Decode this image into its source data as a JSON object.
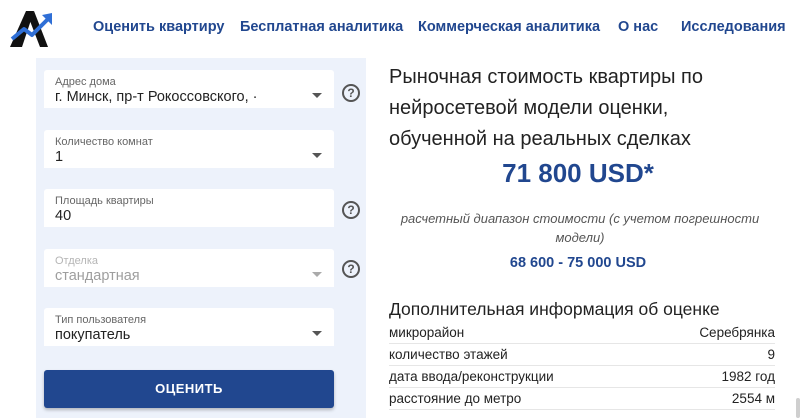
{
  "header": {
    "logo_icon": "analytics-arrow-logo",
    "nav": [
      {
        "label": "Оценить квартиру"
      },
      {
        "label": "Бесплатная аналитика"
      },
      {
        "label": "Коммерческая аналитика"
      },
      {
        "label": "О нас"
      },
      {
        "label": "Исследования"
      }
    ]
  },
  "form": {
    "address": {
      "label": "Адрес дома",
      "value": "г. Минск, пр-т Рокоссовского, ·"
    },
    "rooms": {
      "label": "Количество комнат",
      "value": "1"
    },
    "area": {
      "label": "Площадь квартиры",
      "value": "40"
    },
    "finish": {
      "label": "Отделка",
      "value": "стандартная"
    },
    "user_type": {
      "label": "Тип пользователя",
      "value": "покупатель"
    },
    "help_glyph": "?",
    "submit_label": "ОЦЕНИТЬ"
  },
  "result": {
    "title": "Рыночная стоимость квартиры по нейросетевой модели оценки, обученной на реальных сделках",
    "price": "71 800 USD*",
    "range_note": "расчетный диапазон стоимости (с учетом погрешности модели)",
    "range": "68 600 - 75 000 USD",
    "extra_title": "Дополнительная информация об оценке",
    "rows": [
      {
        "k": "микрорайон",
        "v": "Серебрянка"
      },
      {
        "k": "количество этажей",
        "v": "9"
      },
      {
        "k": "дата ввода/реконструкции",
        "v": "1982 год"
      },
      {
        "k": "расстояние до метро",
        "v": "2554 м"
      }
    ]
  },
  "colors": {
    "brand": "#21478f",
    "panel_bg": "#edf2fb"
  }
}
